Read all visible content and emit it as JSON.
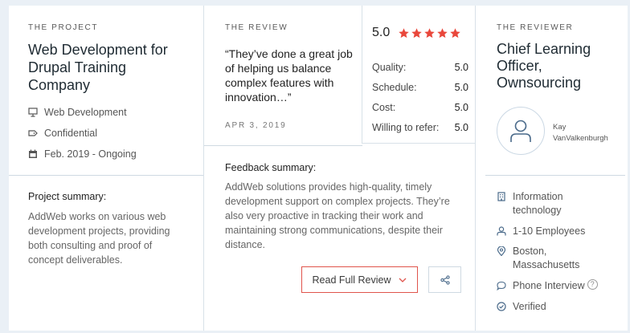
{
  "project": {
    "eyebrow": "The Project",
    "title": "Web Development for Drupal Training Company",
    "service": "Web Development",
    "budget": "Confidential",
    "timeline": "Feb. 2019 - Ongoing",
    "summary_title": "Project summary:",
    "summary_text": "AddWeb works on various web development projects, providing both consulting and proof of concept deliverables."
  },
  "review": {
    "eyebrow": "The Review",
    "quote": "“They’ve done a great job of helping us balance complex features with innovation…”",
    "date": "APR 3, 2019",
    "overall": "5.0",
    "stars": 5,
    "star_color": "#e9473b",
    "ratings": [
      {
        "label": "Quality:",
        "value": "5.0"
      },
      {
        "label": "Schedule:",
        "value": "5.0"
      },
      {
        "label": "Cost:",
        "value": "5.0"
      },
      {
        "label": "Willing to refer:",
        "value": "5.0"
      }
    ],
    "feedback_title": "Feedback summary:",
    "feedback_text": "AddWeb solutions provides high-quality, timely development support on complex projects. They’re also very proactive in tracking their work and maintaining strong communications, despite their distance.",
    "read_button": "Read Full Review"
  },
  "reviewer": {
    "eyebrow": "The Reviewer",
    "title": "Chief Learning Officer, Ownsourcing",
    "name_first": "Kay",
    "name_last": "VanValkenburgh",
    "industry": "Information technology",
    "employees": "1-10 Employees",
    "location": "Boston, Massachusetts",
    "interview": "Phone Interview",
    "verified": "Verified",
    "help_glyph": "?"
  },
  "colors": {
    "accent": "#e9473b",
    "divider": "#cfd9e2",
    "background": "#eaf0f6"
  }
}
